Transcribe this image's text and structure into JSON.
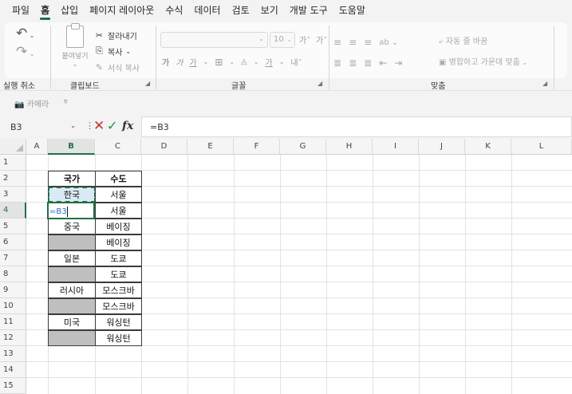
{
  "menu": {
    "tabs": [
      "파일",
      "홈",
      "삽입",
      "페이지 레이아웃",
      "수식",
      "데이터",
      "검토",
      "보기",
      "개발 도구",
      "도움말"
    ],
    "active": "홈"
  },
  "ribbon": {
    "undo_label": "실행 취소",
    "clipboard_label": "클립보드",
    "paste_label": "붙여넣기",
    "cut_label": "잘라내기",
    "copy_label": "복사",
    "format_painter_label": "서식 복사",
    "font_group_label": "글꼴",
    "font_size": "10",
    "align_group_label": "맞춤",
    "wrap_text_label": "자동 줄 바꿈",
    "merge_center_label": "병합하고 가운데 맞춤"
  },
  "qat": {
    "camera_label": "카메라"
  },
  "formula_bar": {
    "name_box": "B3",
    "formula": "=B3"
  },
  "grid": {
    "columns": [
      "A",
      "B",
      "C",
      "D",
      "E",
      "F",
      "G",
      "H",
      "I",
      "J",
      "K",
      "L"
    ],
    "rows": [
      "1",
      "2",
      "3",
      "4",
      "5",
      "6",
      "7",
      "8",
      "9",
      "10",
      "11",
      "12",
      "13",
      "14",
      "15"
    ],
    "selected_column": "B",
    "selected_row": "4"
  },
  "table": {
    "headers": [
      "국가",
      "수도"
    ],
    "rows": [
      {
        "country": "한국",
        "capital": "서울"
      },
      {
        "country": "=B3",
        "capital": "서울"
      },
      {
        "country": "중국",
        "capital": "베이징"
      },
      {
        "country": "",
        "capital": "베이징"
      },
      {
        "country": "일본",
        "capital": "도쿄"
      },
      {
        "country": "",
        "capital": "도쿄"
      },
      {
        "country": "러시아",
        "capital": "모스크바"
      },
      {
        "country": "",
        "capital": "모스크바"
      },
      {
        "country": "미국",
        "capital": "워싱턴"
      },
      {
        "country": "",
        "capital": "워싱턴"
      }
    ]
  },
  "colors": {
    "accent": "#1e7145",
    "blank_fill": "#bfbfbf",
    "copy_fill": "#dbe9f6"
  }
}
